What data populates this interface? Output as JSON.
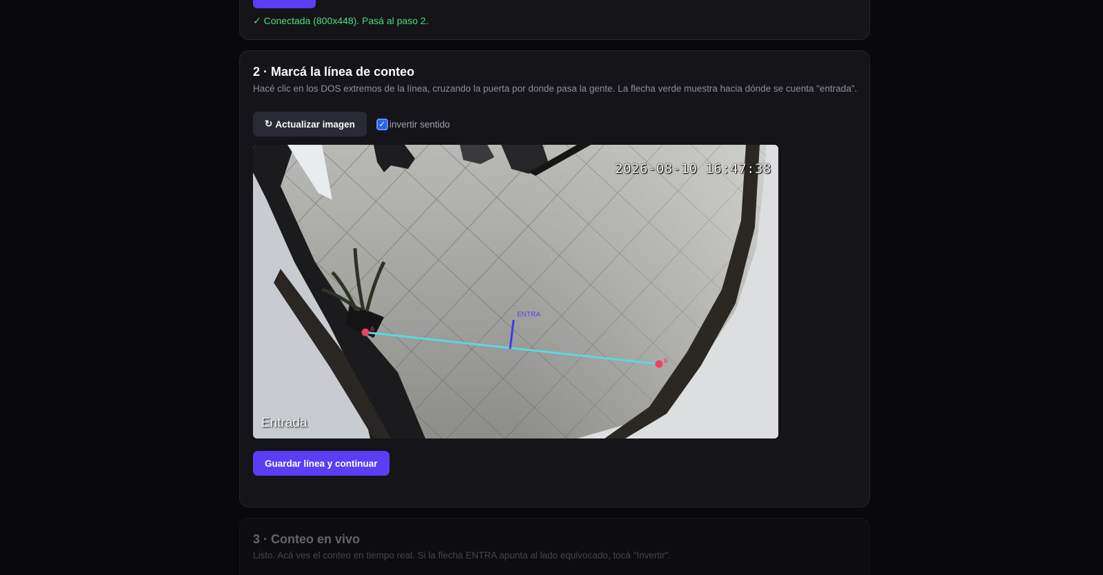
{
  "step1": {
    "status": "✓ Conectada (800x448). Pasá al paso 2."
  },
  "step2": {
    "title": "2 · Marcá la línea de conteo",
    "description": "Hacé clic en los DOS extremos de la línea, cruzando la puerta por donde pasa la gente. La flecha verde muestra hacia dónde se cuenta \"entrada\".",
    "refresh_icon": "↻",
    "refresh_label": "Actualizar imagen",
    "invert_checked": true,
    "invert_label": "invertir sentido",
    "camera": {
      "timestamp": "2026-08-10 16:47:38",
      "label": "Entrada",
      "direction_label": "ENTRA",
      "point_a": "A",
      "point_b": "B",
      "line_color": "#5ad7e6",
      "arrow_color": "#3b3bf0",
      "point_color": "#f43f5e"
    },
    "save_label": "Guardar línea y continuar"
  },
  "step3": {
    "title": "3 · Conteo en vivo",
    "description": "Listo. Acá ves el conteo en tiempo real. Si la flecha ENTRA apunta al lado equivocado, tocá \"Invertir\"."
  },
  "colors": {
    "accent": "#5b3df5",
    "success": "#4ade80",
    "background": "#09090b",
    "card": "#141419"
  }
}
